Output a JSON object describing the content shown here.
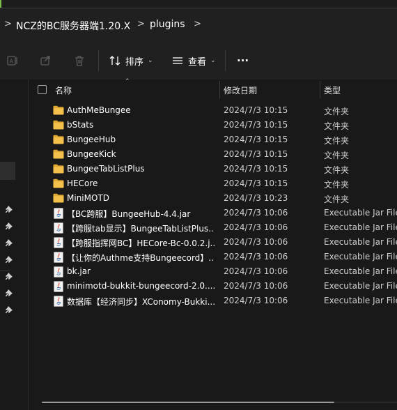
{
  "breadcrumb": {
    "items": [
      "NCZ的BC服务器端1.20.X",
      "plugins"
    ],
    "separator": ">"
  },
  "toolbar": {
    "sort_label": "排序",
    "view_label": "查看",
    "more_label": "···",
    "icons": [
      "rename-icon",
      "share-icon",
      "delete-icon"
    ]
  },
  "columns": {
    "name": "名称",
    "modified": "修改日期",
    "type": "类型"
  },
  "files": [
    {
      "name": "AuthMeBungee",
      "date": "2024/7/3 10:15",
      "type": "文件夹",
      "kind": "folder"
    },
    {
      "name": "bStats",
      "date": "2024/7/3 10:15",
      "type": "文件夹",
      "kind": "folder"
    },
    {
      "name": "BungeeHub",
      "date": "2024/7/3 10:15",
      "type": "文件夹",
      "kind": "folder"
    },
    {
      "name": "BungeeKick",
      "date": "2024/7/3 10:15",
      "type": "文件夹",
      "kind": "folder"
    },
    {
      "name": "BungeeTabListPlus",
      "date": "2024/7/3 10:15",
      "type": "文件夹",
      "kind": "folder"
    },
    {
      "name": "HECore",
      "date": "2024/7/3 10:15",
      "type": "文件夹",
      "kind": "folder"
    },
    {
      "name": "MiniMOTD",
      "date": "2024/7/3 10:23",
      "type": "文件夹",
      "kind": "folder"
    },
    {
      "name": "【BC跨服】BungeeHub-4.4.jar",
      "date": "2024/7/3 10:06",
      "type": "Executable Jar File",
      "kind": "jar"
    },
    {
      "name": "【跨服tab显示】BungeeTabListPlus...",
      "date": "2024/7/3 10:06",
      "type": "Executable Jar File",
      "kind": "jar"
    },
    {
      "name": "【跨服指挥网BC】HECore-Bc-0.0.2.j...",
      "date": "2024/7/3 10:06",
      "type": "Executable Jar File",
      "kind": "jar"
    },
    {
      "name": "【让你的Authme支持Bungeecord】...",
      "date": "2024/7/3 10:06",
      "type": "Executable Jar File",
      "kind": "jar"
    },
    {
      "name": "bk.jar",
      "date": "2024/7/3 10:06",
      "type": "Executable Jar File",
      "kind": "jar"
    },
    {
      "name": "minimotd-bukkit-bungeecord-2.0....",
      "date": "2024/7/3 10:06",
      "type": "Executable Jar File",
      "kind": "jar"
    },
    {
      "name": "数据库【经济同步】XConomy-Bukki...",
      "date": "2024/7/3 10:06",
      "type": "Executable Jar File",
      "kind": "jar"
    }
  ],
  "colors": {
    "folder": "#f3c14b",
    "folder_dark": "#e0a830",
    "background": "#191919",
    "toolbar": "#202020"
  }
}
